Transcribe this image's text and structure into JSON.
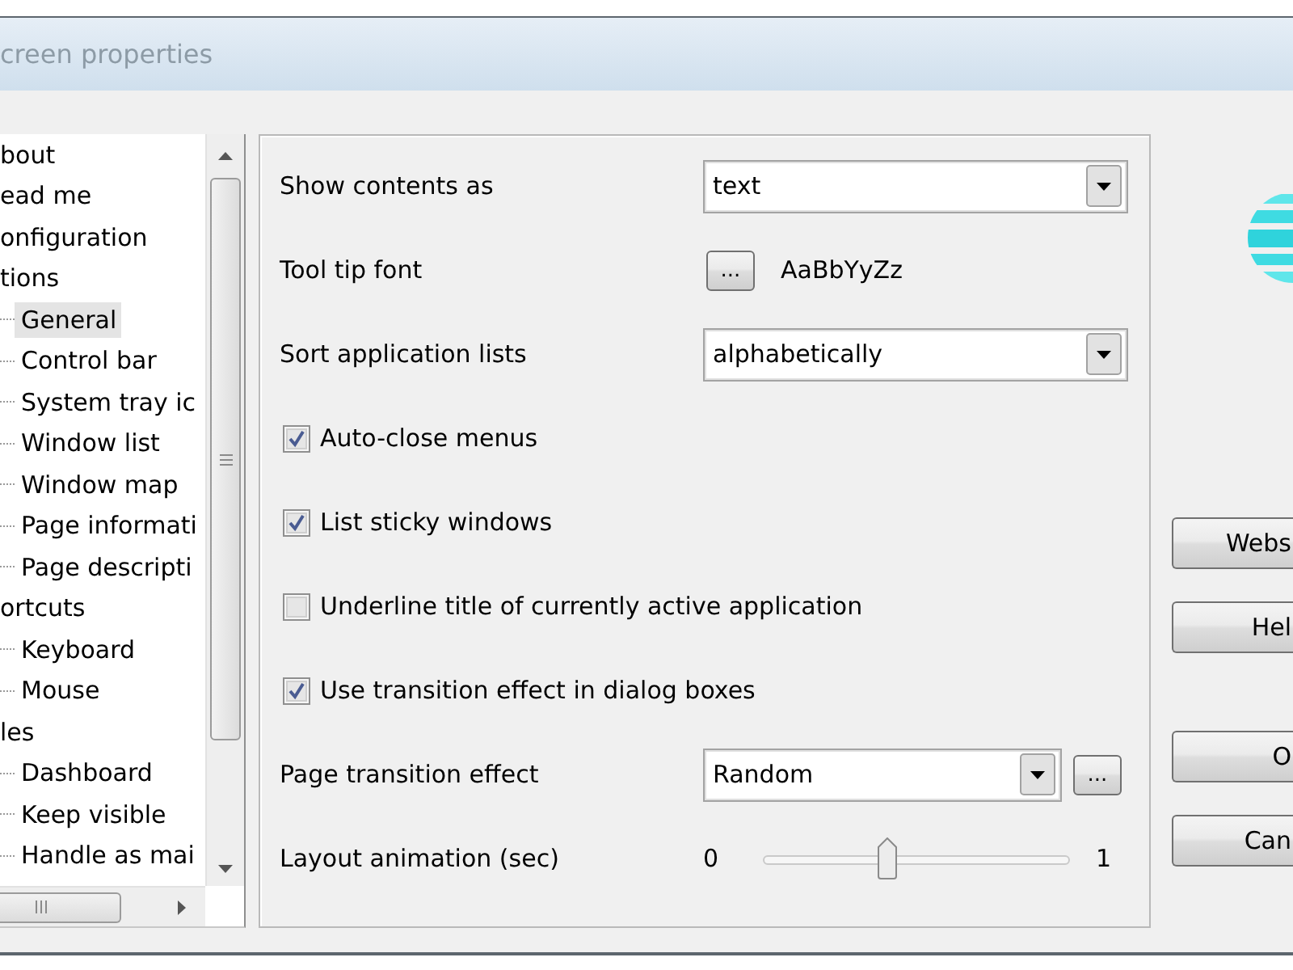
{
  "window": {
    "title": "creen properties"
  },
  "tree": {
    "items": [
      {
        "label": "bout",
        "selected": false
      },
      {
        "label": "ead me",
        "selected": false
      },
      {
        "label": "onfiguration",
        "selected": false
      },
      {
        "label": "tions",
        "selected": false,
        "children": [
          {
            "label": "General",
            "selected": true
          },
          {
            "label": "Control bar",
            "selected": false
          },
          {
            "label": "System tray ic",
            "selected": false
          },
          {
            "label": "Window list",
            "selected": false
          },
          {
            "label": "Window map",
            "selected": false
          },
          {
            "label": "Page informati",
            "selected": false
          },
          {
            "label": "Page descripti",
            "selected": false
          }
        ]
      },
      {
        "label": "ortcuts",
        "selected": false,
        "children": [
          {
            "label": "Keyboard",
            "selected": false
          },
          {
            "label": "Mouse",
            "selected": false
          }
        ]
      },
      {
        "label": "les",
        "selected": false,
        "children": [
          {
            "label": "Dashboard",
            "selected": false
          },
          {
            "label": "Keep visible",
            "selected": false
          },
          {
            "label": "Handle as mai",
            "selected": false
          }
        ]
      }
    ]
  },
  "settings": [
    {
      "kind": "dropdown",
      "label": "Show contents as",
      "value": "text"
    },
    {
      "kind": "font",
      "label": "Tool tip font",
      "button": "...",
      "sample": "AaBbYyZz"
    },
    {
      "kind": "dropdown",
      "label": "Sort application lists",
      "value": "alphabetically"
    },
    {
      "kind": "checkbox",
      "label": "Auto-close menus",
      "checked": true
    },
    {
      "kind": "checkbox",
      "label": "List sticky windows",
      "checked": true
    },
    {
      "kind": "checkbox",
      "label": "Underline title of currently active application",
      "checked": false
    },
    {
      "kind": "checkbox",
      "label": "Use transition effect in dialog boxes",
      "checked": true
    },
    {
      "kind": "dropdown",
      "label": "Page transition effect",
      "value": "Random",
      "button": "..."
    },
    {
      "kind": "slider",
      "label": "Layout animation (sec)",
      "min_label": "0",
      "max_label": "1",
      "level": 0.4
    }
  ],
  "side_buttons": [
    {
      "label": "Webs"
    },
    {
      "label": "Hel"
    }
  ],
  "dialog_buttons": [
    {
      "label": "O"
    },
    {
      "label": "Can"
    }
  ]
}
